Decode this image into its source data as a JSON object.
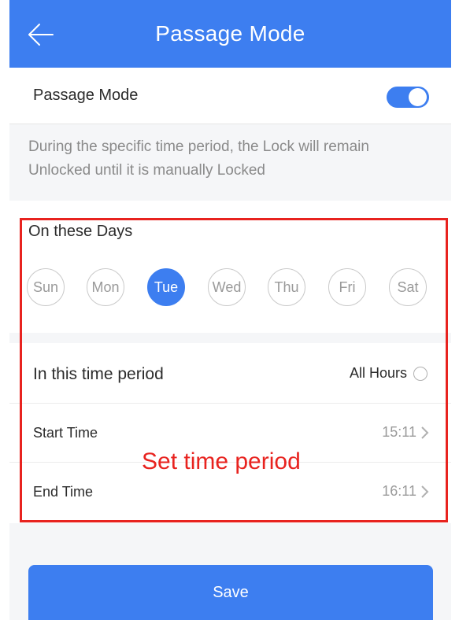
{
  "header": {
    "title": "Passage Mode",
    "back_icon": "arrow-left-icon"
  },
  "passage_toggle": {
    "label": "Passage Mode",
    "enabled": true,
    "color": "#3d7ef0"
  },
  "description": "During the specific time period, the Lock will remain Unlocked until it is manually Locked",
  "days_section": {
    "title": "On these Days",
    "days": [
      {
        "label": "Sun",
        "selected": false
      },
      {
        "label": "Mon",
        "selected": false
      },
      {
        "label": "Tue",
        "selected": true
      },
      {
        "label": "Wed",
        "selected": false
      },
      {
        "label": "Thu",
        "selected": false
      },
      {
        "label": "Fri",
        "selected": false
      },
      {
        "label": "Sat",
        "selected": false
      }
    ]
  },
  "time_section": {
    "period_label": "In this time period",
    "all_hours_label": "All Hours",
    "all_hours_selected": false,
    "start_label": "Start Time",
    "start_value": "15:11",
    "end_label": "End Time",
    "end_value": "16:11"
  },
  "annotation": {
    "text": "Set time period",
    "color": "#e8231f"
  },
  "save_label": "Save",
  "colors": {
    "accent": "#3d7ef0",
    "background": "#f5f6f8"
  }
}
